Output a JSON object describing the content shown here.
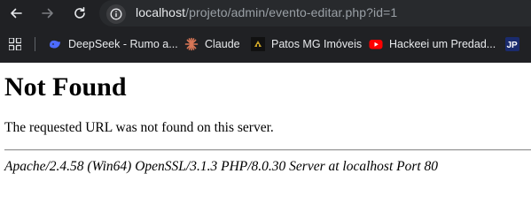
{
  "browser": {
    "url_host": "localhost",
    "url_path": "/projeto/admin/evento-editar.php?id=1",
    "bookmarks": [
      {
        "label": "DeepSeek - Rumo a...",
        "icon": "deepseek-whale-icon",
        "color": "#4d6bfe"
      },
      {
        "label": "Claude",
        "icon": "claude-sunburst-icon",
        "color": "#d97757"
      },
      {
        "label": "Patos MG Imóveis",
        "icon": "patos-imoveis-logo-icon",
        "color": "#c9a227"
      },
      {
        "label": "Hackeei um Predad...",
        "icon": "youtube-icon",
        "color": "#ff0000"
      },
      {
        "label": "",
        "icon": "jp-logo-icon",
        "color": "#1a2b6d"
      }
    ]
  },
  "page": {
    "title": "Not Found",
    "message": "The requested URL was not found on this server.",
    "server_signature": "Apache/2.4.58 (Win64) OpenSSL/3.1.3 PHP/8.0.30 Server at localhost Port 80"
  }
}
